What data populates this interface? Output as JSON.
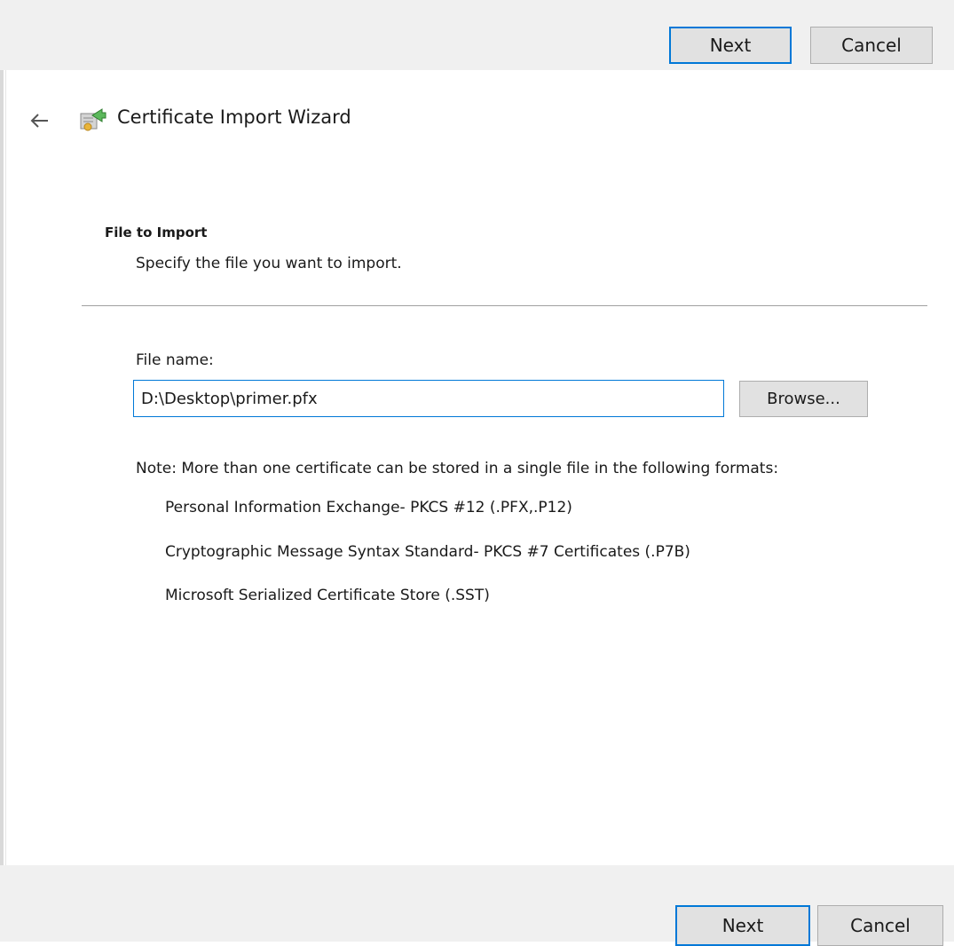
{
  "top_toolbar": {
    "next_label": "Next",
    "cancel_label": "Cancel"
  },
  "header": {
    "back_icon": "back-arrow-icon",
    "wizard_icon": "certificate-icon",
    "title": "Certificate Import Wizard"
  },
  "section": {
    "title": "File to Import",
    "description": "Specify the file you want to import."
  },
  "file_input": {
    "label": "File name:",
    "value": "D:\\Desktop\\primer.pfx",
    "browse_label": "Browse..."
  },
  "note": {
    "text": "Note:  More than one certificate can be stored in a single file in the following formats:",
    "formats": [
      "Personal Information Exchange- PKCS #12 (.PFX,.P12)",
      "Cryptographic Message Syntax Standard- PKCS #7 Certificates (.P7B)",
      "Microsoft Serialized Certificate Store (.SST)"
    ]
  },
  "bottom_toolbar": {
    "next_label": "Next",
    "cancel_label": "Cancel"
  },
  "colors": {
    "accent": "#0078d7",
    "bar_background": "#f0f0f0",
    "button_background": "#e1e1e1"
  }
}
